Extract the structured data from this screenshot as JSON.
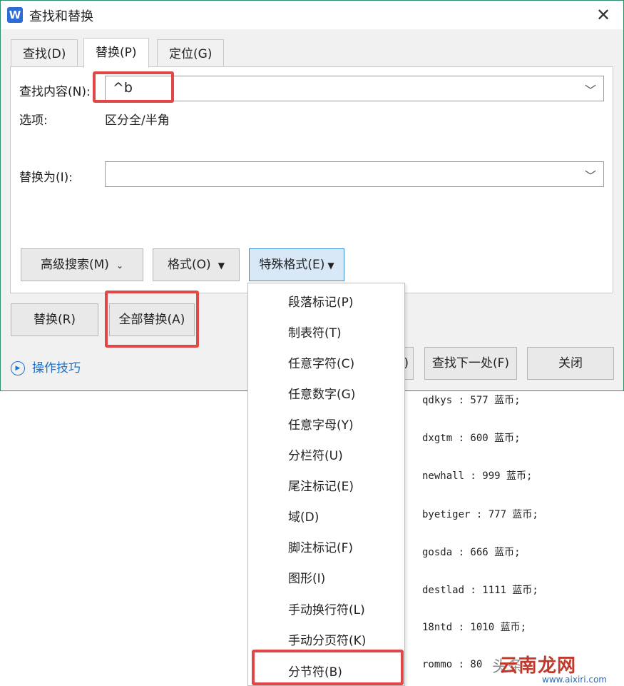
{
  "document": {
    "lines": [
      "qdkys : 577 蓝币;",
      "dxgtm : 600 蓝币;",
      "newhall : 999 蓝币;",
      "byetiger : 777 蓝币;",
      "gosda : 666 蓝币;",
      "destlad : 1111 蓝币;",
      "18ntd : 1010 蓝币;",
      "rommo : 80"
    ],
    "watermark_gray": "头条",
    "watermark": "云南龙网",
    "watermark_url": "www.aixiri.com"
  },
  "dialog": {
    "title": "查找和替换",
    "app_icon": "W",
    "close_glyph": "✕",
    "tabs": [
      {
        "label": "查找(D)"
      },
      {
        "label": "替换(P)"
      },
      {
        "label": "定位(G)"
      }
    ],
    "find_label": "查找内容(N):",
    "find_value": "^b",
    "options_label": "选项:",
    "options_value": "区分全/半角",
    "replace_label": "替换为(I):",
    "replace_value": "",
    "advanced_button": "高级搜索(M)",
    "format_button": "格式(O)",
    "special_button": "特殊格式(E)",
    "replace_button": "替换(R)",
    "replace_all_button": "全部替换(A)",
    "tips_link": "操作技巧",
    "find_next_button": "查找下一处(F)",
    "close_button": "关闭",
    "hidden_button_tail": ")"
  },
  "special_menu": {
    "items": [
      "段落标记(P)",
      "制表符(T)",
      "任意字符(C)",
      "任意数字(G)",
      "任意字母(Y)",
      "分栏符(U)",
      "尾注标记(E)",
      "域(D)",
      "脚注标记(F)",
      "图形(I)",
      "手动换行符(L)",
      "手动分页符(K)",
      "分节符(B)"
    ]
  },
  "colors": {
    "highlight": "#e04848",
    "dialog_border": "#2f8f6a",
    "link": "#1f73c9"
  }
}
